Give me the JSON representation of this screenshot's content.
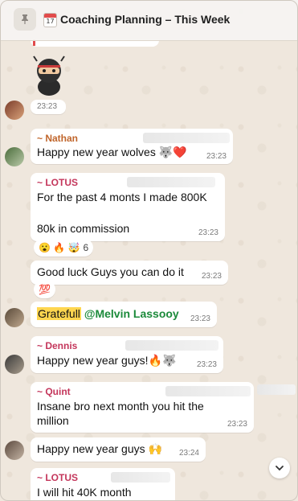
{
  "header": {
    "title": "Coaching Planning – This Week",
    "calendar_day": "17"
  },
  "messages": [
    {
      "time": "23:23"
    },
    {
      "sender": "~ Nathan",
      "sender_color": "#c0652b",
      "text": "Happy new year wolves 🐺❤️",
      "time": "23:23"
    },
    {
      "sender": "~ LOTUS",
      "sender_color": "#c4365b",
      "line1": "For the past 4 monts I made 800K",
      "line2": "80k in commission",
      "time": "23:23",
      "reactions": "😮 🔥 🤯",
      "reaction_count": "6"
    },
    {
      "text": "Good luck Guys you can do it",
      "time": "23:23",
      "reaction": "💯"
    },
    {
      "text_highlight": "Gratefull",
      "mention": "@Melvin Lassooy",
      "time": "23:23"
    },
    {
      "sender": "~ Dennis",
      "sender_color": "#c4365b",
      "text": "Happy new year guys!🔥🐺",
      "time": "23:23"
    },
    {
      "sender": "~ Quint",
      "sender_color": "#c4365b",
      "line1": "Insane bro next month you hit the",
      "line2": "million",
      "time": "23:23"
    },
    {
      "text": "Happy new year guys 🙌",
      "time": "23:24"
    },
    {
      "sender": "~ LOTUS",
      "sender_color": "#c4365b",
      "text": "I will hit 40K month"
    }
  ]
}
